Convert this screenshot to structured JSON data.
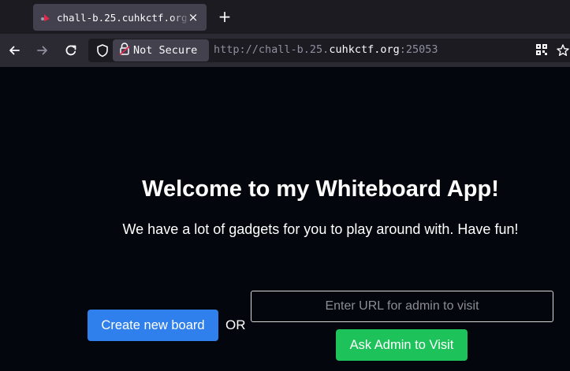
{
  "browser": {
    "tab_title": "chall-b.25.cuhkctf.org:25053",
    "tab_close": "×",
    "new_tab": "+",
    "security_label": "Not Secure",
    "url_scheme": "http://",
    "url_sub": "chall-b.25.",
    "url_domain": "cuhkctf.org",
    "url_port": ":25053"
  },
  "page": {
    "title": "Welcome to my Whiteboard App!",
    "subtitle": "We have a lot of gadgets for you to play around with. Have fun!",
    "create_button": "Create new board",
    "or_label": "OR",
    "url_placeholder": "Enter URL for admin to visit",
    "visit_button": "Ask Admin to Visit"
  },
  "colors": {
    "background": "#03060c",
    "primary_button": "#2f80ed",
    "success_button": "#1ec25a"
  },
  "icons": [
    "favicon-icon",
    "close-icon",
    "plus-icon",
    "back-arrow-icon",
    "forward-arrow-icon",
    "reload-icon",
    "shield-icon",
    "lock-warning-icon",
    "qr-code-icon",
    "star-icon"
  ]
}
